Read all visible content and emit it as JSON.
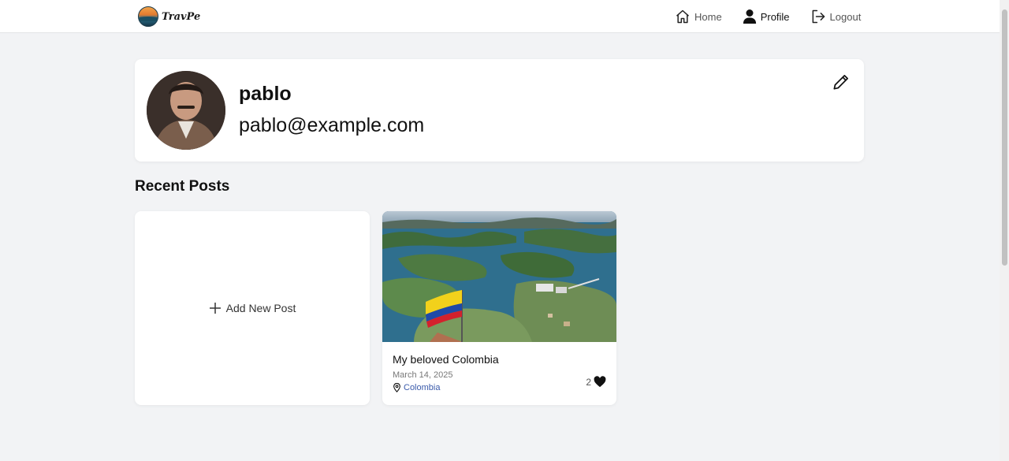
{
  "header": {
    "logo_text": "TravPe",
    "nav": [
      {
        "label": "Home",
        "icon": "home-icon"
      },
      {
        "label": "Profile",
        "icon": "user-icon"
      },
      {
        "label": "Logout",
        "icon": "logout-icon"
      }
    ]
  },
  "profile": {
    "username": "pablo",
    "email": "pablo@example.com",
    "edit_icon": "pencil-icon"
  },
  "recent_posts": {
    "title": "Recent Posts",
    "add_label": "Add New Post",
    "posts": [
      {
        "title": "My beloved Colombia",
        "date": "March 14, 2025",
        "location": "Colombia",
        "likes": "2"
      }
    ]
  },
  "colors": {
    "background": "#f2f3f5",
    "card": "#ffffff",
    "location_link": "#3b5bab"
  }
}
